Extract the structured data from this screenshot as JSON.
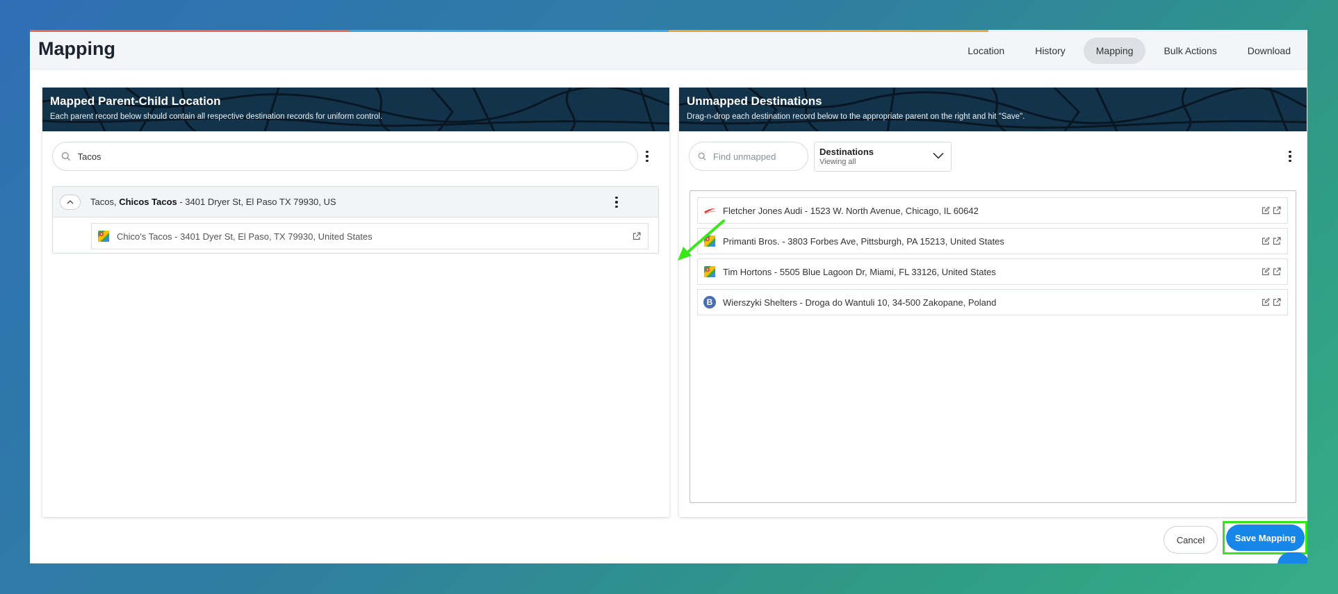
{
  "header": {
    "title": "Mapping",
    "tabs": [
      {
        "label": "Location",
        "active": false
      },
      {
        "label": "History",
        "active": false
      },
      {
        "label": "Mapping",
        "active": true
      },
      {
        "label": "Bulk Actions",
        "active": false
      },
      {
        "label": "Download",
        "active": false
      }
    ]
  },
  "left_panel": {
    "title": "Mapped Parent-Child Location",
    "subtitle": "Each parent record below should contain all respective destination records for uniform control.",
    "search_value": "Tacos",
    "parent": {
      "name_prefix": "Tacos, ",
      "name_bold": "Chicos Tacos",
      "address": " - 3401 Dryer St, El Paso TX 79930, US"
    },
    "child": {
      "text": "Chico's Tacos - 3401 Dyer St, El Paso, TX 79930, United States",
      "icon": "google-maps-icon"
    }
  },
  "right_panel": {
    "title": "Unmapped Destinations",
    "subtitle": "Drag-n-drop each destination record below to the appropriate parent on the right and hit \"Save\".",
    "search_placeholder": "Find unmapped",
    "filter": {
      "label": "Destinations",
      "sub": "Viewing all"
    },
    "items": [
      {
        "text": "Fletcher Jones Audi - 1523 W. North Avenue, Chicago, IL 60642",
        "icon": "brand-swoosh-icon"
      },
      {
        "text": "Primanti Bros. - 3803 Forbes Ave, Pittsburgh, PA 15213, United States",
        "icon": "google-maps-icon"
      },
      {
        "text": "Tim Hortons - 5505 Blue Lagoon Dr, Miami, FL 33126, United States",
        "icon": "google-maps-icon"
      },
      {
        "text": "Wierszyki Shelters - Droga do Wantuli 10, 34-500 Zakopane, Poland",
        "icon": "bing-b-icon",
        "glyph": "B"
      }
    ]
  },
  "footer": {
    "cancel_label": "Cancel",
    "save_label": "Save Mapping"
  },
  "colors": {
    "accent": "#1686e8",
    "highlight": "#33e61a",
    "banner": "#13334a"
  }
}
